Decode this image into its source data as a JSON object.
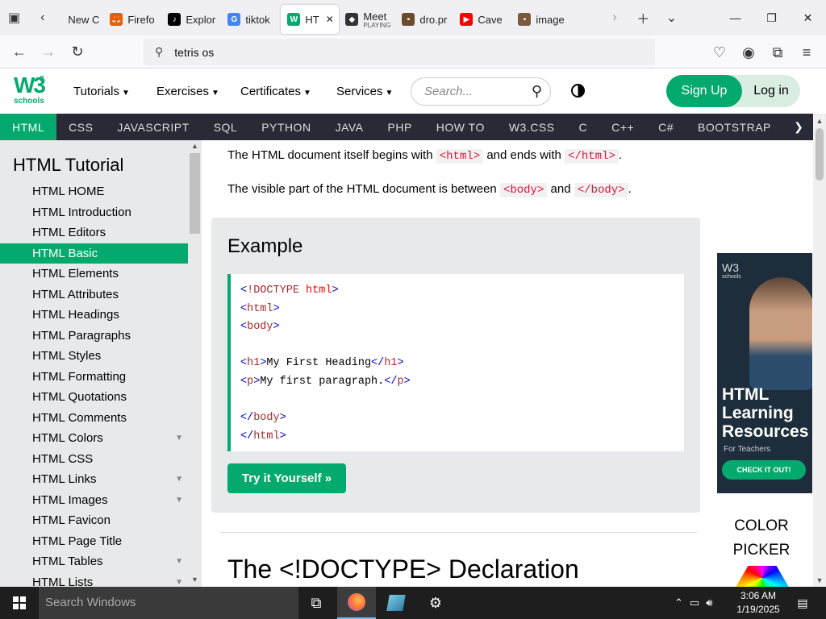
{
  "browser": {
    "tabs": [
      {
        "label": "New C",
        "fav": "",
        "color": "#666"
      },
      {
        "label": "Firefo",
        "fav": "🦊",
        "color": "#e66000"
      },
      {
        "label": "Explor",
        "fav": "♪",
        "color": "#000"
      },
      {
        "label": "tiktok",
        "fav": "G",
        "color": "#4285f4"
      },
      {
        "label": "HT",
        "fav": "W",
        "color": "#04aa6d"
      },
      {
        "label": "Meet",
        "sub": "PLAYING",
        "fav": "◆",
        "color": "#333"
      },
      {
        "label": "dro.pr",
        "fav": "▪",
        "color": "#6b4b2a"
      },
      {
        "label": "Cave",
        "fav": "▶",
        "color": "#ff0000"
      },
      {
        "label": "image",
        "fav": "▪",
        "color": "#7a5a3a"
      }
    ],
    "url": "tetris os"
  },
  "header": {
    "logo_text": "W3",
    "logo_sup": "3",
    "logo_sub": "schools",
    "menu": [
      "Tutorials",
      "Exercises",
      "Certificates",
      "Services"
    ],
    "search_placeholder": "Search...",
    "signup": "Sign Up",
    "login": "Log in"
  },
  "topics": [
    "HTML",
    "CSS",
    "JAVASCRIPT",
    "SQL",
    "PYTHON",
    "JAVA",
    "PHP",
    "HOW TO",
    "W3.CSS",
    "C",
    "C++",
    "C#",
    "BOOTSTRAP"
  ],
  "sidebar": {
    "title": "HTML Tutorial",
    "items": [
      {
        "label": "HTML HOME"
      },
      {
        "label": "HTML Introduction"
      },
      {
        "label": "HTML Editors"
      },
      {
        "label": "HTML Basic",
        "active": true
      },
      {
        "label": "HTML Elements"
      },
      {
        "label": "HTML Attributes"
      },
      {
        "label": "HTML Headings"
      },
      {
        "label": "HTML Paragraphs"
      },
      {
        "label": "HTML Styles"
      },
      {
        "label": "HTML Formatting"
      },
      {
        "label": "HTML Quotations"
      },
      {
        "label": "HTML Comments"
      },
      {
        "label": "HTML Colors",
        "expand": true
      },
      {
        "label": "HTML CSS"
      },
      {
        "label": "HTML Links",
        "expand": true
      },
      {
        "label": "HTML Images",
        "expand": true
      },
      {
        "label": "HTML Favicon"
      },
      {
        "label": "HTML Page Title"
      },
      {
        "label": "HTML Tables",
        "expand": true
      },
      {
        "label": "HTML Lists",
        "expand": true
      }
    ]
  },
  "main": {
    "para1_a": "The HTML document itself begins with",
    "para1_tag1": "<html>",
    "para1_b": "and ends with",
    "para1_tag2": "</html>",
    "para1_c": ".",
    "para2_a": "The visible part of the HTML document is between",
    "para2_tag1": "<body>",
    "para2_b": "and",
    "para2_tag2": "</body>",
    "para2_c": ".",
    "example_title": "Example",
    "code_lines": [
      "<!DOCTYPE html>",
      "<html>",
      "<body>",
      "",
      "<h1>My First Heading</h1>",
      "<p>My first paragraph.</p>",
      "",
      "</body>",
      "</html>"
    ],
    "try_button": "Try it Yourself »",
    "section_heading": "The <!DOCTYPE> Declaration"
  },
  "ad": {
    "logo": "W3",
    "logo_sub": "schools",
    "headline": "HTML Learning Resources",
    "sub": "For Teachers",
    "cta": "CHECK IT OUT!"
  },
  "color_picker": "COLOR PICKER",
  "taskbar": {
    "search_placeholder": "Search Windows",
    "time": "3:06 AM",
    "date": "1/19/2025"
  }
}
